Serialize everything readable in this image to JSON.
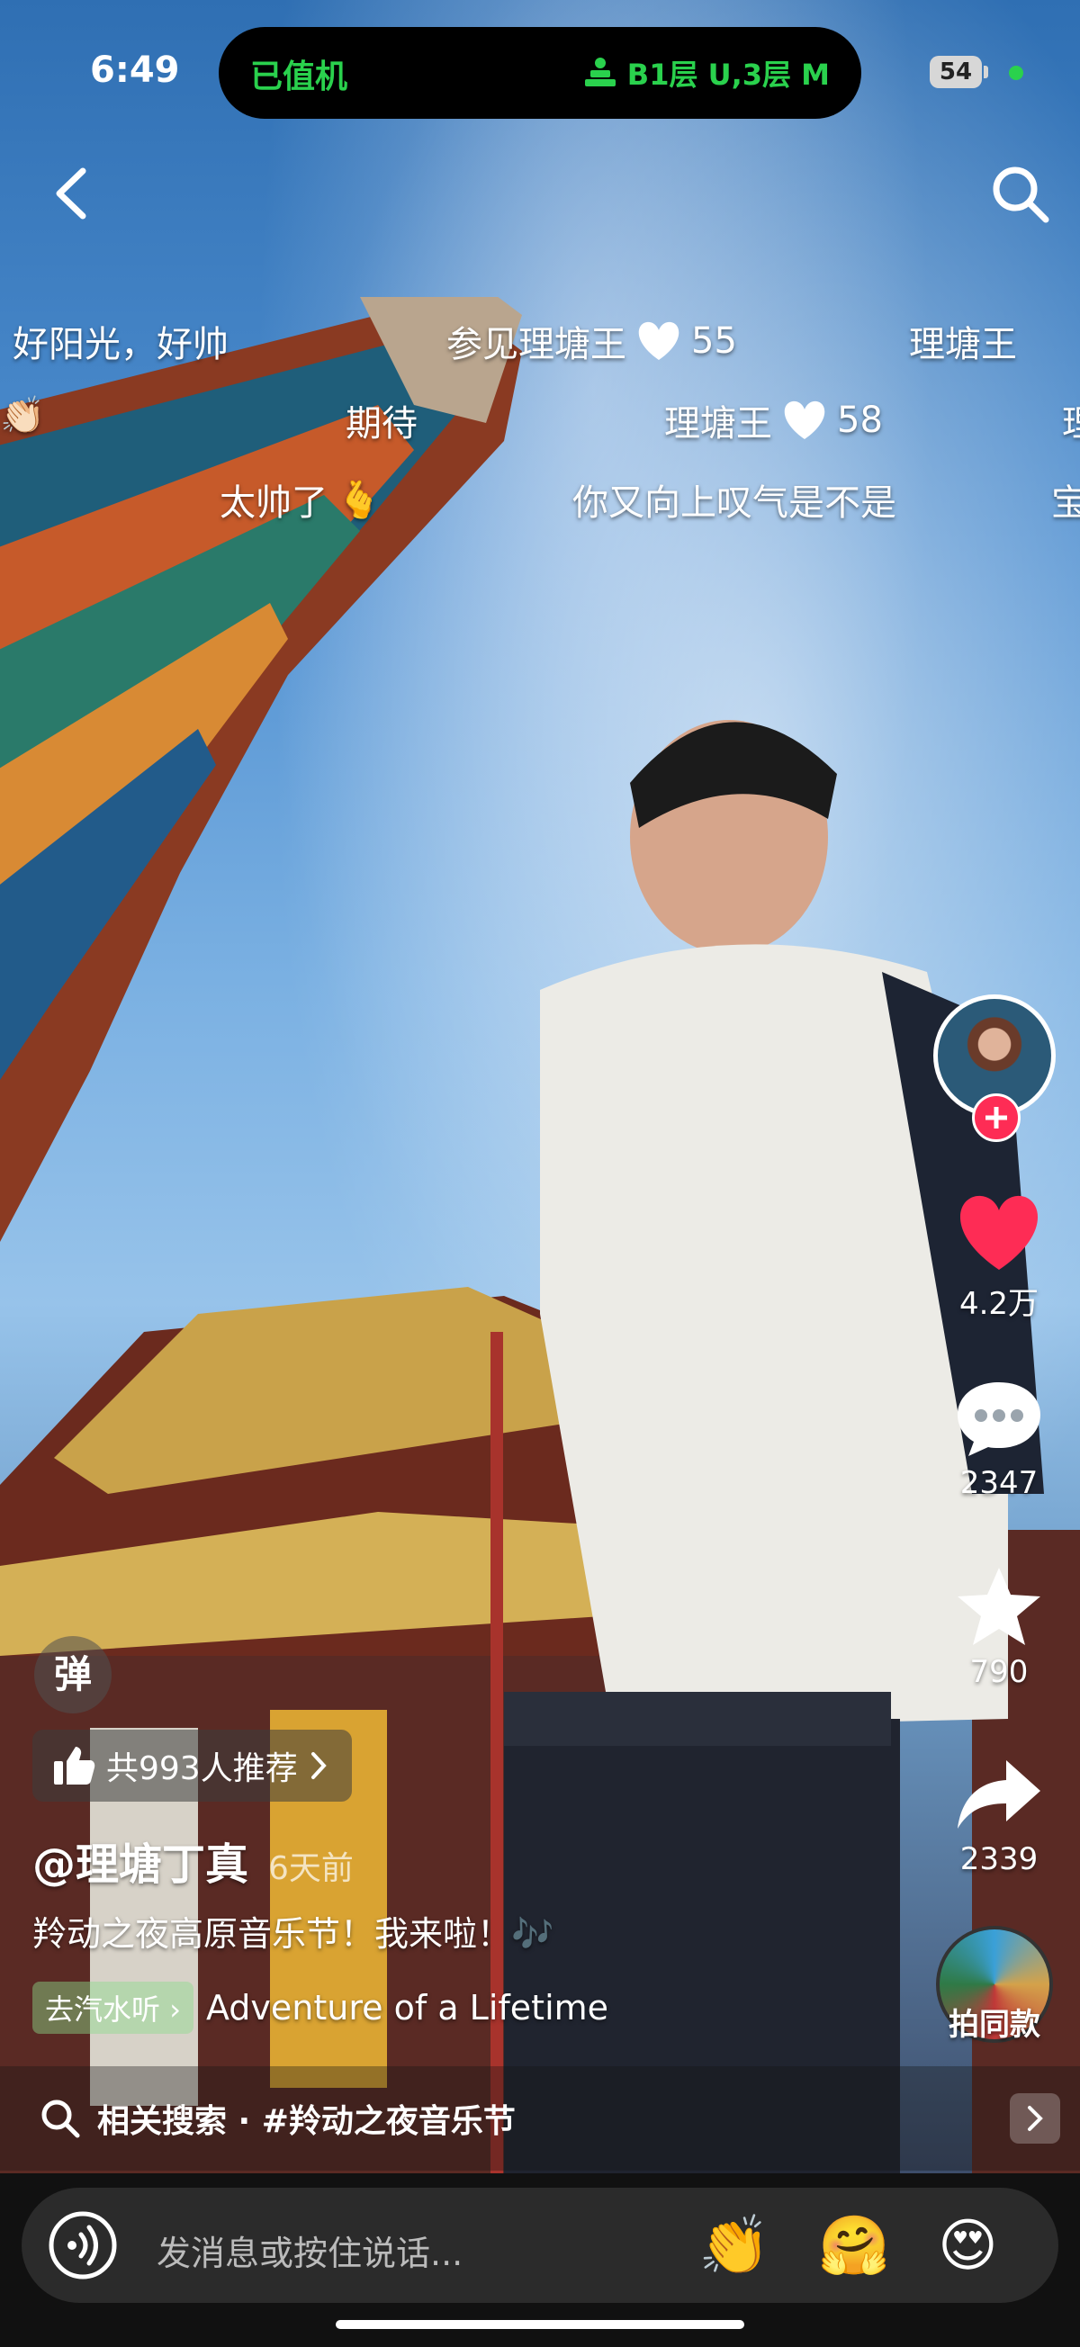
{
  "status_bar": {
    "time": "6:49",
    "island_left": "已值机",
    "island_right": "B1层 U,3层 M",
    "battery": "54"
  },
  "danmaku": [
    {
      "text": "好阳光，好帅"
    },
    {
      "text": "参见理塘王",
      "likes": "55"
    },
    {
      "text": "理塘王"
    },
    {
      "text": "期待"
    },
    {
      "text": "理塘王",
      "likes": "58"
    },
    {
      "text": "太帅了"
    },
    {
      "text": "你又向上叹气是不是"
    },
    {
      "text": "理"
    },
    {
      "text": "宝"
    }
  ],
  "actions": {
    "likes": "4.2万",
    "comments": "2347",
    "favorites": "790",
    "shares": "2339",
    "same_music": "拍同款"
  },
  "video_info": {
    "danmaku_toggle": "弹",
    "recommend": "共993人推荐",
    "author": "@理塘丁真",
    "time_ago": "6天前",
    "caption": "羚动之夜高原音乐节！我来啦！🎶",
    "music_badge": "去汽水听",
    "music_title": "Adventure of a Lifetime"
  },
  "related": {
    "text": "相关搜索 · #羚动之夜音乐节"
  },
  "input": {
    "placeholder": "发消息或按住说话...",
    "emojis": [
      "👏",
      "🤗",
      "😍"
    ]
  },
  "colors": {
    "accent_green": "#2ad14d",
    "like_red": "#fe2c55"
  }
}
